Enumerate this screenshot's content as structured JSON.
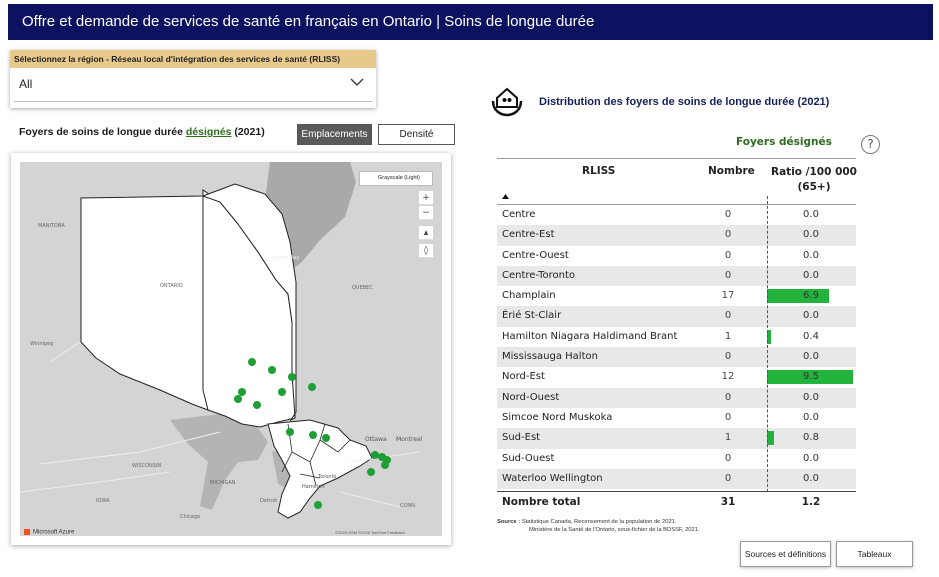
{
  "header": {
    "title": "Offre et demande de services de santé en français en Ontario | Soins de longue durée"
  },
  "region_filter": {
    "label": "Sélectionnez la région - Réseau local d'intégration des services de santé (RLISS)",
    "value": "All"
  },
  "map_section": {
    "title_prefix": "Foyers de soins de longue durée",
    "title_link": "désignés",
    "title_suffix": "(2021)",
    "toggle_emplacements": "Emplacements",
    "toggle_densite": "Densité",
    "map_style": "Grayscale (Light)",
    "labels": [
      "MANITOBA",
      "ONTARIO",
      "James Bay",
      "QUEBEC",
      "Winnipeg",
      "WISCONSIN",
      "MICHIGAN",
      "IOWA",
      "Chicago",
      "Ottawa",
      "Montreal",
      "Toronto",
      "Hamilton",
      "Detroit",
      "CONN."
    ],
    "attribution": "©2025 OSM ©2025 TomTom Feedback",
    "brand": "Microsoft Azure",
    "accent_color": "#1e9e35"
  },
  "distribution": {
    "title": "Distribution des foyers de soins de longue durée (2021)",
    "group_header": "Foyers désignés",
    "columns": {
      "rliss": "RLISS",
      "nombre": "Nombre",
      "ratio": "Ratio /100 000 (65+)"
    },
    "sort_icon": "sort-ascending-icon",
    "bar_color": "#23b23c",
    "rows": [
      {
        "rliss": "Centre",
        "nombre": "0",
        "ratio": "0.0"
      },
      {
        "rliss": "Centre-Est",
        "nombre": "0",
        "ratio": "0.0"
      },
      {
        "rliss": "Centre-Ouest",
        "nombre": "0",
        "ratio": "0.0"
      },
      {
        "rliss": "Centre-Toronto",
        "nombre": "0",
        "ratio": "0.0"
      },
      {
        "rliss": "Champlain",
        "nombre": "17",
        "ratio": "6.9"
      },
      {
        "rliss": "Érié St-Clair",
        "nombre": "0",
        "ratio": "0.0"
      },
      {
        "rliss": "Hamilton Niagara Haldimand Brant",
        "nombre": "1",
        "ratio": "0.4"
      },
      {
        "rliss": "Mississauga Halton",
        "nombre": "0",
        "ratio": "0.0"
      },
      {
        "rliss": "Nord-Est",
        "nombre": "12",
        "ratio": "9.5"
      },
      {
        "rliss": "Nord-Ouest",
        "nombre": "0",
        "ratio": "0.0"
      },
      {
        "rliss": "Simcoe Nord Muskoka",
        "nombre": "0",
        "ratio": "0.0"
      },
      {
        "rliss": "Sud-Est",
        "nombre": "1",
        "ratio": "0.8"
      },
      {
        "rliss": "Sud-Ouest",
        "nombre": "0",
        "ratio": "0.0"
      },
      {
        "rliss": "Waterloo Wellington",
        "nombre": "0",
        "ratio": "0.0"
      }
    ],
    "total": {
      "label": "Nombre total",
      "nombre": "31",
      "ratio": "1.2"
    },
    "source_label": "Source :",
    "source_line1": "Statistique Canada, Recensement de la population de 2021.",
    "source_line2": "Ministère de la Santé de l'Ontario, sous-fichier de la BDSSF, 2021."
  },
  "buttons": {
    "sources": "Sources et définitions",
    "tableaux": "Tableaux"
  }
}
